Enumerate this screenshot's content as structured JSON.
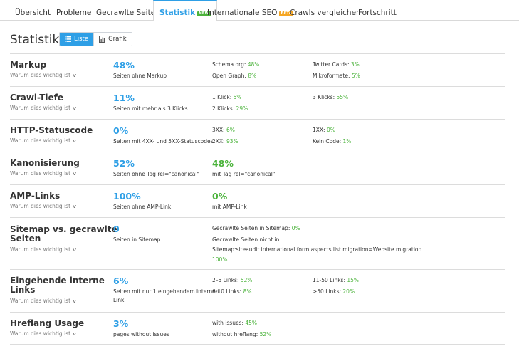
{
  "tabs": [
    {
      "label": "Übersicht"
    },
    {
      "label": "Probleme"
    },
    {
      "label": "Gecrawlte Seiten"
    },
    {
      "label": "Statistik",
      "badge": "new"
    },
    {
      "label": "Internationale SEO",
      "badge": "beta"
    },
    {
      "label": "Crawls vergleichen"
    },
    {
      "label": "Fortschritt"
    }
  ],
  "page_title": "Statistik",
  "view_toggle": {
    "list": "Liste",
    "chart": "Grafik"
  },
  "why_label": "Warum dies wichtig ist",
  "colors": {
    "accent": "#2e9fe6",
    "green": "#4bb33b",
    "beta": "#f5a623"
  },
  "rows": [
    {
      "title": "Markup",
      "main_pct": "48%",
      "main_desc": "Seiten ohne Markup",
      "stats": [
        {
          "label": "Schema.org:",
          "value": "48%"
        },
        {
          "label": "Twitter Cards:",
          "value": "3%"
        },
        {
          "label": "Open Graph:",
          "value": "8%"
        },
        {
          "label": "Mikroformate:",
          "value": "5%"
        }
      ]
    },
    {
      "title": "Crawl-Tiefe",
      "main_pct": "11%",
      "main_desc": "Seiten mit mehr als 3 Klicks",
      "stats": [
        {
          "label": "1 Klick:",
          "value": "5%"
        },
        {
          "label": "3 Klicks:",
          "value": "55%"
        },
        {
          "label": "2 Klicks:",
          "value": "29%"
        }
      ]
    },
    {
      "title": "HTTP-Statuscode",
      "main_pct": "0%",
      "main_desc": "Seiten mit 4XX- und 5XX-Statuscodes",
      "stats": [
        {
          "label": "3XX:",
          "value": "6%"
        },
        {
          "label": "1XX:",
          "value": "0%"
        },
        {
          "label": "2XX:",
          "value": "93%"
        },
        {
          "label": "Kein Code:",
          "value": "1%"
        }
      ]
    },
    {
      "title": "Kanonisierung",
      "main_pct": "52%",
      "main_desc": "Seiten ohne Tag rel=\"canonical\"",
      "second_pct": "48%",
      "second_desc": "mit Tag rel=\"canonical\""
    },
    {
      "title": "AMP-Links",
      "main_pct": "100%",
      "main_desc": "Seiten ohne AMP-Link",
      "second_pct": "0%",
      "second_desc": "mit AMP-Link"
    },
    {
      "title_line1": "Sitemap vs. gecrawlte",
      "title_line2": "Seiten",
      "main_pct": "0",
      "main_desc": "Seiten in Sitemap",
      "stats": [
        {
          "label": "Gecrawlte Seiten in Sitemap:",
          "value": "0%"
        },
        {
          "label": "Gecrawlte Seiten nicht in",
          "value": ""
        },
        {
          "label": "Sitemap:siteaudit.international.form.aspects.list.migration=Website migration",
          "value": ""
        },
        {
          "label": "",
          "value": "100%"
        }
      ]
    },
    {
      "title_line1": "Eingehende interne",
      "title_line2": "Links",
      "main_pct": "6%",
      "main_desc_line1": "Seiten mit nur 1 eingehendem internen",
      "main_desc_line2": "Link",
      "stats": [
        {
          "label": "2–5 Links:",
          "value": "52%"
        },
        {
          "label": "11-50 Links:",
          "value": "15%"
        },
        {
          "label": "6-10 Links:",
          "value": "8%"
        },
        {
          "label": ">50 Links:",
          "value": "20%"
        }
      ]
    },
    {
      "title": "Hreflang Usage",
      "main_pct": "3%",
      "main_desc": "pages without issues",
      "stats": [
        {
          "label": "with issues:",
          "value": "45%"
        },
        {
          "label": "without hreflang:",
          "value": "52%"
        }
      ]
    }
  ]
}
